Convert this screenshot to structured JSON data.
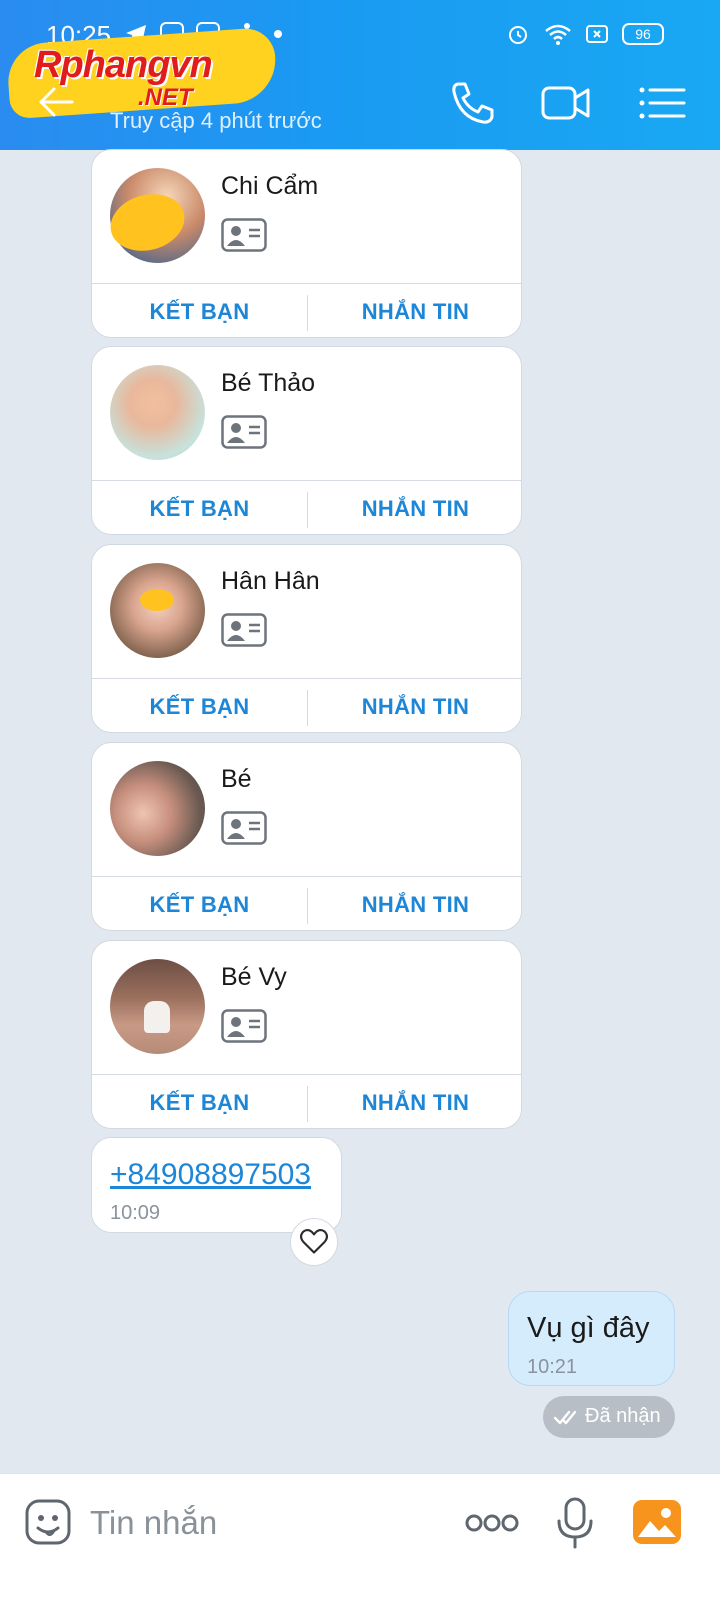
{
  "status_bar": {
    "time": "10:25",
    "battery": "96"
  },
  "header": {
    "logo_main": "Rphangvn",
    "logo_sub": ".NET",
    "subtitle": "Truy cập 4 phút trước"
  },
  "contacts": [
    {
      "name": "Chi Cẩm",
      "add_label": "KẾT BẠN",
      "msg_label": "NHẮN TIN",
      "avatar_color": "#c98a6a"
    },
    {
      "name": "Bé Thảo",
      "add_label": "KẾT BẠN",
      "msg_label": "NHẮN TIN",
      "avatar_color": "#c7e2dc"
    },
    {
      "name": "Hân Hân",
      "add_label": "KẾT BẠN",
      "msg_label": "NHẮN TIN",
      "avatar_color": "#8a6a55"
    },
    {
      "name": "Bé",
      "add_label": "KẾT BẠN",
      "msg_label": "NHẮN TIN",
      "avatar_color": "#6b5a52"
    },
    {
      "name": "Bé Vy",
      "add_label": "KẾT BẠN",
      "msg_label": "NHẮN TIN",
      "avatar_color": "#9a6f5d"
    }
  ],
  "phone_message": {
    "number": "+84908897503",
    "time": "10:09"
  },
  "sent_message": {
    "text": "Vụ gì đây",
    "time": "10:21",
    "status": "Đã nhận"
  },
  "composer": {
    "placeholder": "Tin nhắn"
  },
  "colors": {
    "header_blue": "#1a9af2",
    "link_blue": "#1d86d6",
    "sent_bubble": "#d5ecfd",
    "chat_bg": "#e2e8f0"
  }
}
